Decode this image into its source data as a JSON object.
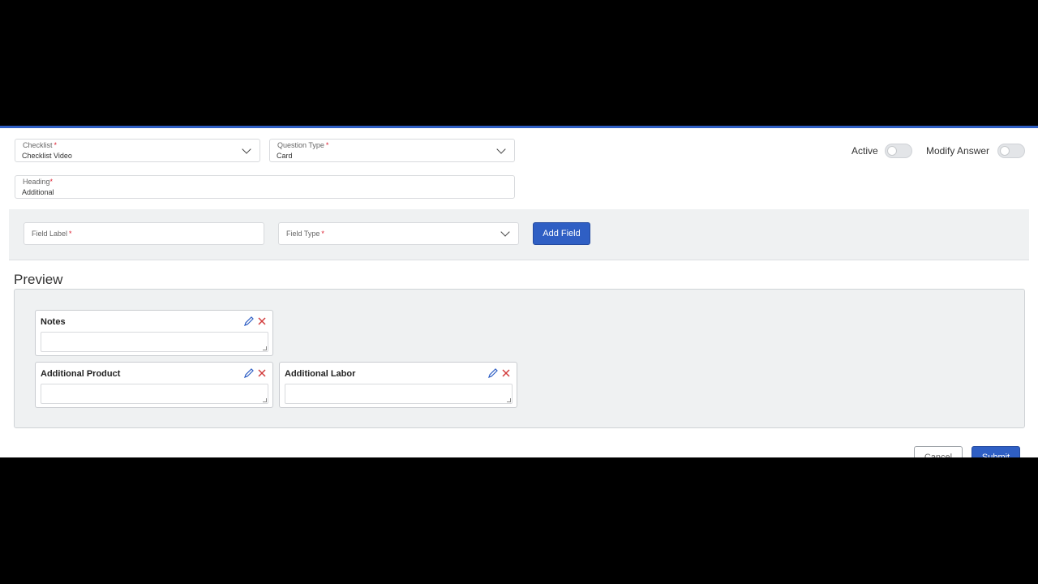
{
  "form": {
    "checklist": {
      "label": "Checklist",
      "required_mark": "*",
      "value": "Checklist Video"
    },
    "question_type": {
      "label": "Question Type",
      "required_mark": "*",
      "value": "Card"
    },
    "heading": {
      "label": "Heading",
      "required_mark": "*",
      "value": "Additional"
    },
    "toggles": {
      "active_label": "Active",
      "modify_answer_label": "Modify Answer"
    }
  },
  "add_field": {
    "field_label": {
      "placeholder": "Field Label",
      "required_mark": "*"
    },
    "field_type": {
      "placeholder": "Field Type",
      "required_mark": "*"
    },
    "button_label": "Add Field"
  },
  "preview": {
    "title": "Preview",
    "cards": [
      {
        "title": "Notes"
      },
      {
        "title": "Additional Product"
      },
      {
        "title": "Additional Labor"
      }
    ]
  },
  "footer": {
    "cancel_label": "Cancel",
    "submit_label": "Submit"
  },
  "colors": {
    "accent": "#2f5fc4",
    "delete": "#d23c3c",
    "edit": "#2f5fc4"
  }
}
